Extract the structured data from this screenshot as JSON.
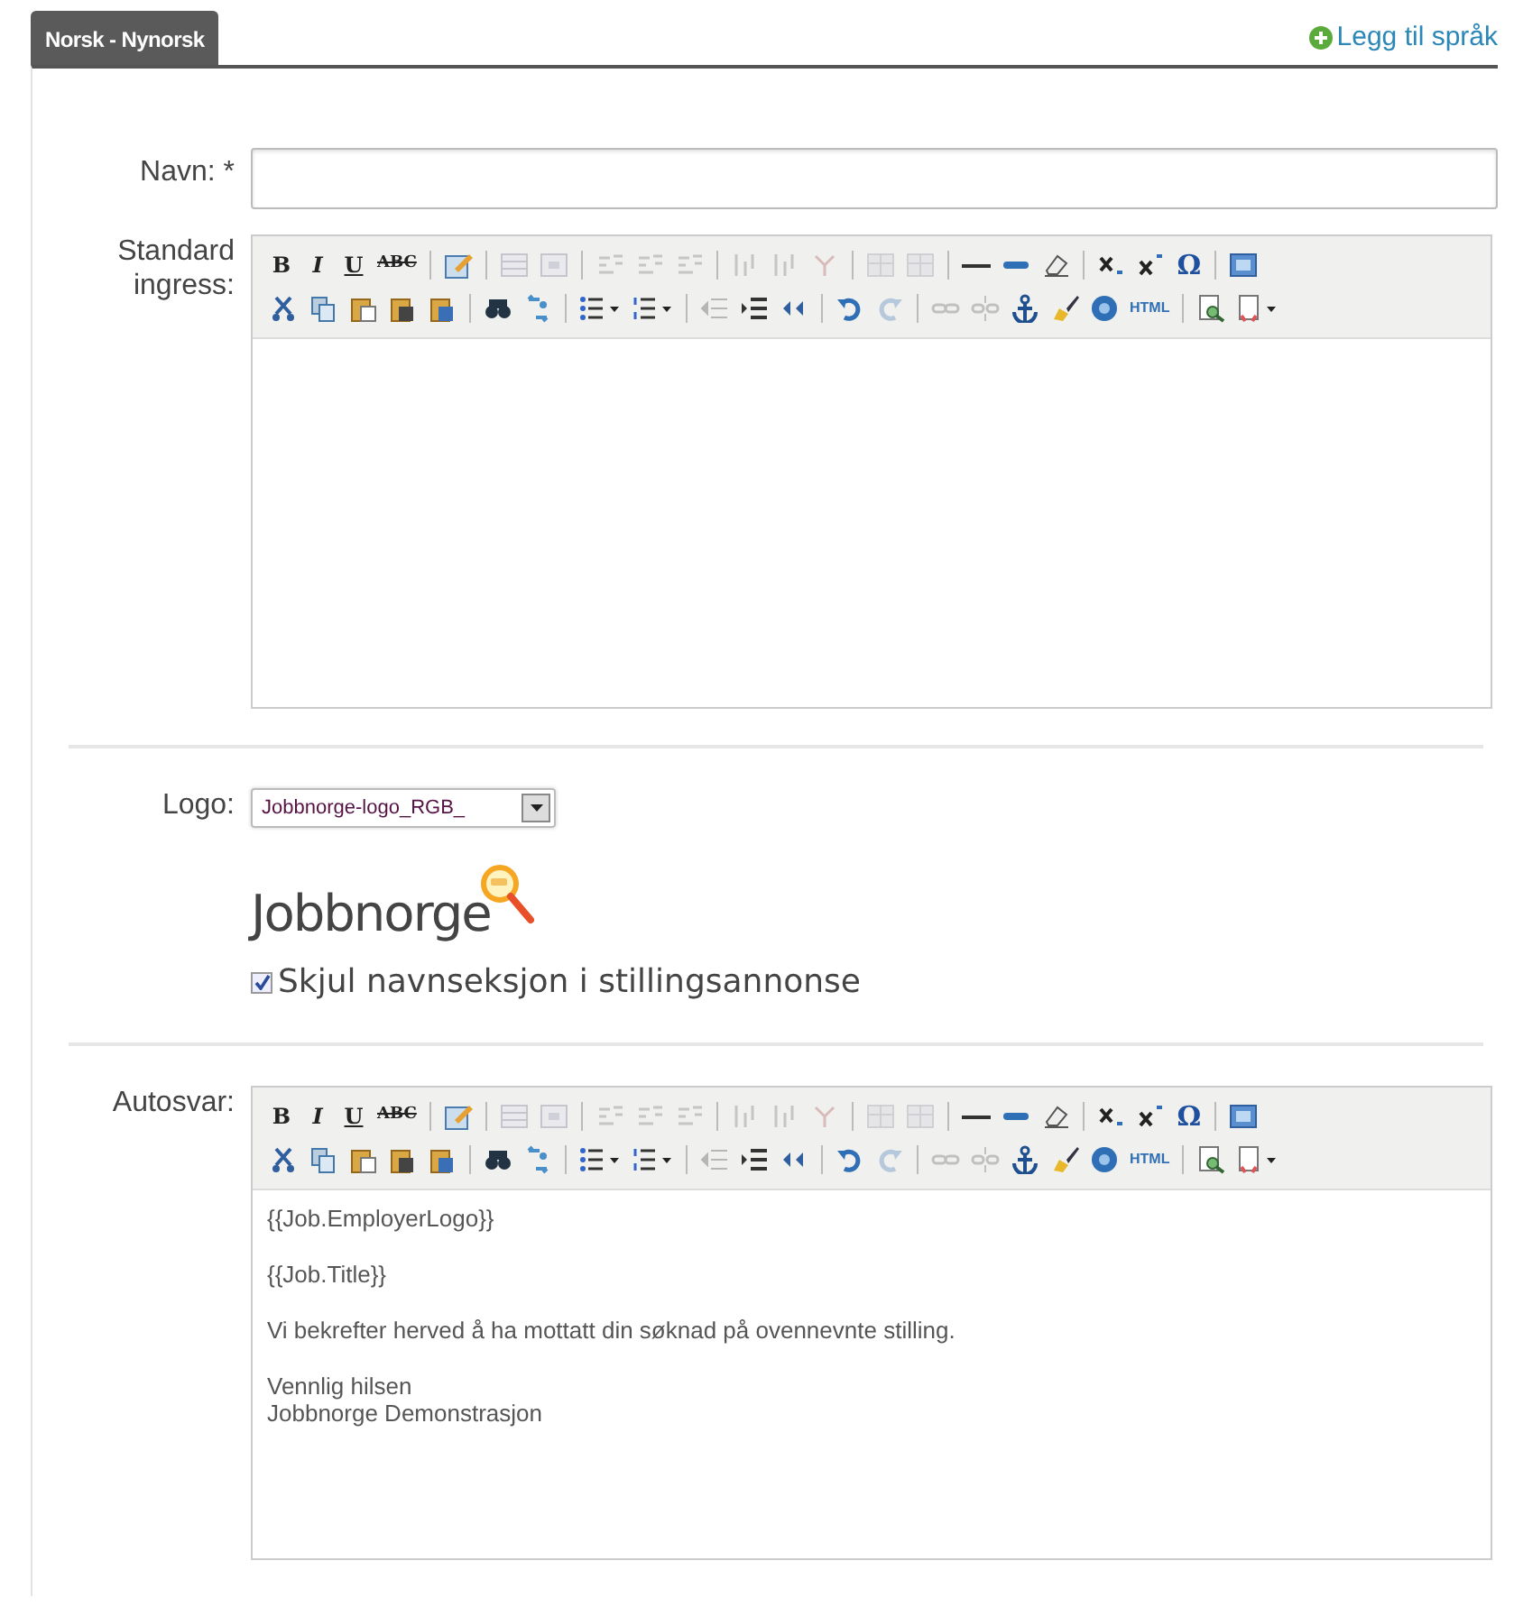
{
  "tabs": [
    {
      "label": "Norsk - Nynorsk",
      "selected": true
    }
  ],
  "add_language_link": "Legg til språk",
  "fields": [
    {
      "kind": "text",
      "label": "Navn: *"
    },
    {
      "kind": "editor",
      "label": "Standard ingress:",
      "toolbar": [
        [
          [
            {
              "label": "B",
              "disabled": false
            },
            {
              "label": "I",
              "disabled": false
            },
            {
              "label": "U",
              "disabled": false
            },
            {
              "label": "ABC",
              "disabled": false
            }
          ],
          [
            {
              "disabled": false
            }
          ],
          [
            {
              "disabled": true
            },
            {
              "disabled": true
            }
          ],
          [
            {
              "disabled": true
            },
            {
              "disabled": true
            },
            {
              "disabled": true
            }
          ],
          [
            {
              "disabled": true
            },
            {
              "disabled": true
            },
            {
              "disabled": true
            }
          ],
          [
            {
              "disabled": true
            },
            {
              "disabled": true
            }
          ],
          [
            {
              "disabled": false
            },
            {
              "disabled": false
            },
            {
              "disabled": false
            }
          ],
          [
            {
              "disabled": false
            },
            {
              "disabled": false
            },
            {
              "label": "Ω",
              "disabled": false
            }
          ],
          [
            {
              "disabled": false
            }
          ]
        ],
        [
          [
            {
              "disabled": false
            },
            {
              "disabled": false
            },
            {
              "disabled": false
            },
            {
              "disabled": false
            },
            {
              "disabled": false
            }
          ],
          [
            {
              "disabled": false
            },
            {
              "disabled": false
            }
          ],
          [
            {
              "disabled": false
            },
            {
              "disabled": false
            }
          ],
          [
            {
              "disabled": true
            },
            {
              "disabled": false
            },
            {
              "disabled": false
            }
          ],
          [
            {
              "disabled": false
            },
            {
              "disabled": true
            }
          ],
          [
            {
              "disabled": true
            },
            {
              "disabled": true
            },
            {
              "disabled": false
            },
            {
              "disabled": false
            },
            {
              "disabled": false
            },
            {
              "label": "HTML",
              "disabled": false
            }
          ],
          [
            {
              "disabled": false
            },
            {
              "disabled": false
            }
          ]
        ]
      ]
    },
    {
      "kind": "divider"
    },
    {
      "kind": "logo",
      "label": "Logo:",
      "value": "Jobbnorge-logo_RGB_",
      "logo_text": "Jobbnorge",
      "checkbox": {
        "label": "Skjul navnseksjon i stillingsannonse",
        "checked": true
      }
    },
    {
      "kind": "divider"
    },
    {
      "kind": "editor",
      "label": "Autosvar:",
      "toolbar": [
        [
          [
            {
              "label": "B",
              "disabled": false
            },
            {
              "label": "I",
              "disabled": false
            },
            {
              "label": "U",
              "disabled": false
            },
            {
              "label": "ABC",
              "disabled": false
            }
          ],
          [
            {
              "disabled": false
            }
          ],
          [
            {
              "disabled": true
            },
            {
              "disabled": true
            }
          ],
          [
            {
              "disabled": true
            },
            {
              "disabled": true
            },
            {
              "disabled": true
            }
          ],
          [
            {
              "disabled": true
            },
            {
              "disabled": true
            },
            {
              "disabled": true
            }
          ],
          [
            {
              "disabled": true
            },
            {
              "disabled": true
            }
          ],
          [
            {
              "disabled": false
            },
            {
              "disabled": false
            },
            {
              "disabled": false
            }
          ],
          [
            {
              "disabled": false
            },
            {
              "disabled": false
            },
            {
              "label": "Ω",
              "disabled": false
            }
          ],
          [
            {
              "disabled": false
            }
          ]
        ],
        [
          [
            {
              "disabled": false
            },
            {
              "disabled": false
            },
            {
              "disabled": false
            },
            {
              "disabled": false
            },
            {
              "disabled": false
            }
          ],
          [
            {
              "disabled": false
            },
            {
              "disabled": false
            }
          ],
          [
            {
              "disabled": false
            },
            {
              "disabled": false
            }
          ],
          [
            {
              "disabled": true
            },
            {
              "disabled": false
            },
            {
              "disabled": false
            }
          ],
          [
            {
              "disabled": false
            },
            {
              "disabled": true
            }
          ],
          [
            {
              "disabled": true
            },
            {
              "disabled": true
            },
            {
              "disabled": false
            },
            {
              "disabled": false
            },
            {
              "disabled": false
            },
            {
              "label": "HTML",
              "disabled": false
            }
          ],
          [
            {
              "disabled": false
            },
            {
              "disabled": false
            }
          ]
        ]
      ],
      "paragraphs": [
        "{{Job.EmployerLogo}}",
        "{{Job.Title}}",
        "Vi bekrefter herved å ha mottatt din søknad på ovennevnte stilling.",
        "Vennlig hilsen\nJobbnorge Demonstrasjon"
      ]
    }
  ]
}
